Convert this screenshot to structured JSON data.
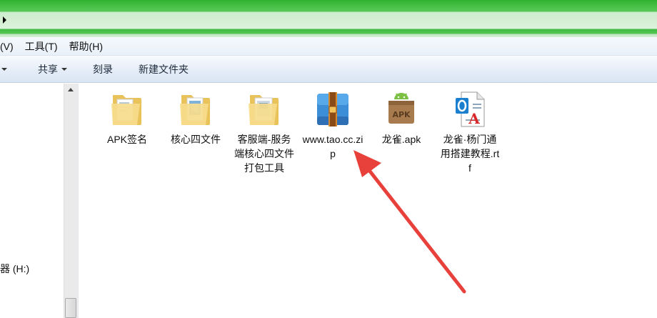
{
  "menu": {
    "items": [
      "(V)",
      "工具(T)",
      "帮助(H)"
    ]
  },
  "toolbar": {
    "share_label": "共享",
    "burn_label": "刻录",
    "new_folder_label": "新建文件夹"
  },
  "nav": {
    "drive_label": "器 (H:)"
  },
  "files": [
    {
      "name": "APK签名",
      "icon": "folder-icon"
    },
    {
      "name": "核心四文件",
      "icon": "folder-icon"
    },
    {
      "name": "客服端-服务端核心四文件打包工具",
      "icon": "folder-icon"
    },
    {
      "name": "www.tao.cc.zip",
      "icon": "winrar-zip-icon"
    },
    {
      "name": "龙雀.apk",
      "icon": "android-apk-icon"
    },
    {
      "name": "龙雀·杨门通用搭建教程.rtf",
      "icon": "rtf-document-icon"
    }
  ],
  "colors": {
    "title_green": "#3fba3f",
    "toolbar_blue": "#dae5f3",
    "annotation_arrow": "#e8403a"
  }
}
